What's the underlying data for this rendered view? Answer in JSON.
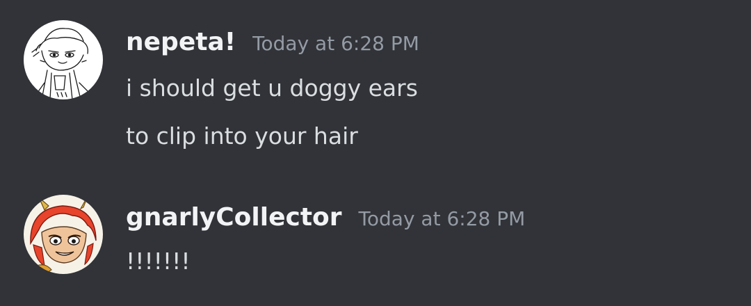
{
  "theme": {
    "background": "#313338",
    "username_color": "#f2f3f5",
    "timestamp_color": "#949ba4",
    "text_color": "#dbdee1"
  },
  "messages": [
    {
      "author": "nepeta!",
      "timestamp": "Today at 6:28 PM",
      "avatar_icon": "sketch-character-avatar",
      "lines": [
        "i should get u doggy ears",
        "to clip into your hair"
      ]
    },
    {
      "author": "gnarlyCollector",
      "timestamp": "Today at 6:28 PM",
      "avatar_icon": "red-haired-character-avatar",
      "lines": [
        "!!!!!!!"
      ]
    }
  ]
}
